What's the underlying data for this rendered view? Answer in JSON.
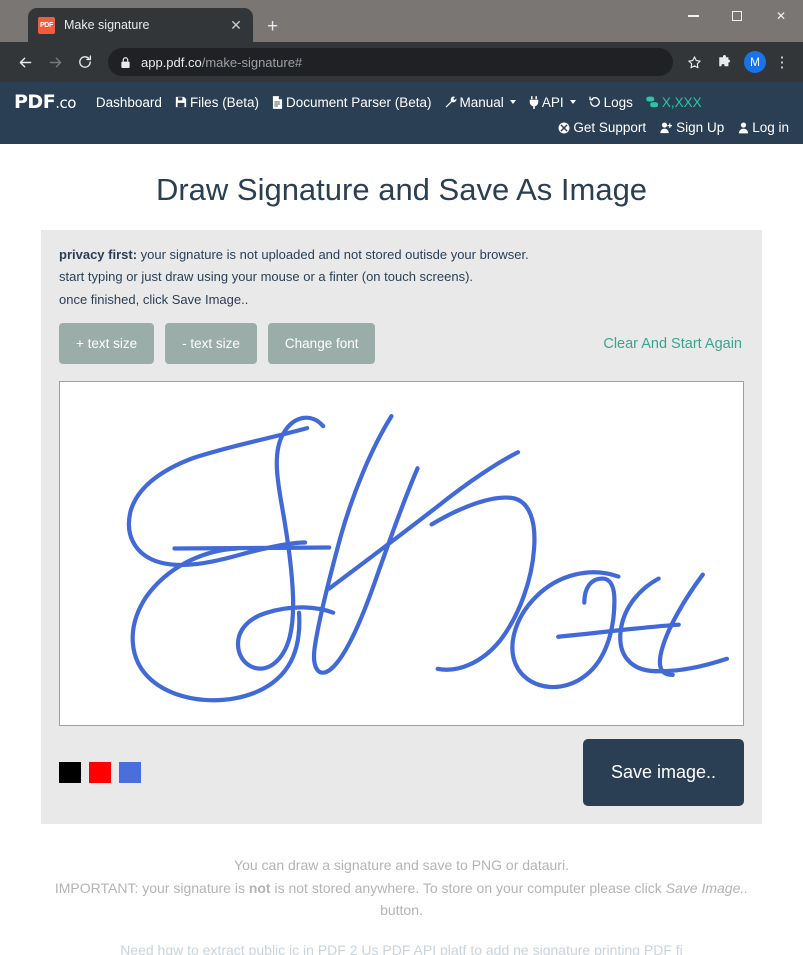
{
  "browser": {
    "tab": {
      "title": "Make signature",
      "favicon_label": "PDF",
      "close_icon": "close-icon"
    },
    "new_tab_label": "+",
    "window_controls": {
      "minimize": "minimize-icon",
      "maximize": "maximize-icon",
      "close": "close-icon"
    },
    "back_icon": "back-arrow-icon",
    "forward_icon": "forward-arrow-icon",
    "reload_icon": "reload-icon",
    "lock_icon": "lock-icon",
    "url_domain": "app.pdf.co",
    "url_path": "/make-signature#",
    "bookmark_icon": "star-icon",
    "extensions_icon": "puzzle-icon",
    "profile_initial": "M",
    "menu_icon": "kebab-menu-icon"
  },
  "site_header": {
    "logo_main": "PDF",
    "logo_suffix": ".co",
    "nav": [
      {
        "label": "Dashboard",
        "icon": null
      },
      {
        "label": "Files (Beta)",
        "icon": "floppy-disk-icon"
      },
      {
        "label": "Document Parser (Beta)",
        "icon": "document-icon"
      },
      {
        "label": "Manual",
        "icon": "wrench-icon",
        "caret": true
      },
      {
        "label": "API",
        "icon": "plug-icon",
        "caret": true
      },
      {
        "label": "Logs",
        "icon": "history-icon"
      },
      {
        "label": "X,XXX",
        "icon": "coins-icon",
        "credits": true
      }
    ],
    "account": [
      {
        "label": "Get Support",
        "icon": "help-circle-icon"
      },
      {
        "label": "Sign Up",
        "icon": "user-plus-icon"
      },
      {
        "label": "Log in",
        "icon": "user-icon"
      }
    ]
  },
  "main": {
    "title": "Draw Signature and Save As Image",
    "privacy": {
      "label": "privacy first:",
      "line1_rest": " your signature is not uploaded and not stored outisde your browser.",
      "line2": "start typing or just draw using your mouse or a finter (on touch screens).",
      "line3": "once finished, click Save Image.."
    },
    "buttons": {
      "increase_text": "+ text size",
      "decrease_text": "- text size",
      "change_font": "Change font",
      "clear": "Clear And Start Again",
      "save": "Save image.."
    },
    "colors": [
      {
        "name": "black",
        "hex": "#000000"
      },
      {
        "name": "red",
        "hex": "#fe0000"
      },
      {
        "name": "blue",
        "hex": "#4a6fdc"
      }
    ],
    "signature": {
      "stroke_color": "#4169d8",
      "stroke_width": 4,
      "canvas_border_color": "#4ac0e0"
    }
  },
  "footer": {
    "line1": "You can draw a signature and save to PNG or datauri.",
    "line2_a": "IMPORTANT: your signature is ",
    "line2_b": "not",
    "line2_c": " is not stored anywhere. To store on your computer please click ",
    "line2_d": "Save Image..",
    "line3": "button.",
    "line4_partial": "Need hqw to extract public  ic in  PDF  2 Us  PDF    API  platf      to add ne  signature  printing PDF fi"
  }
}
